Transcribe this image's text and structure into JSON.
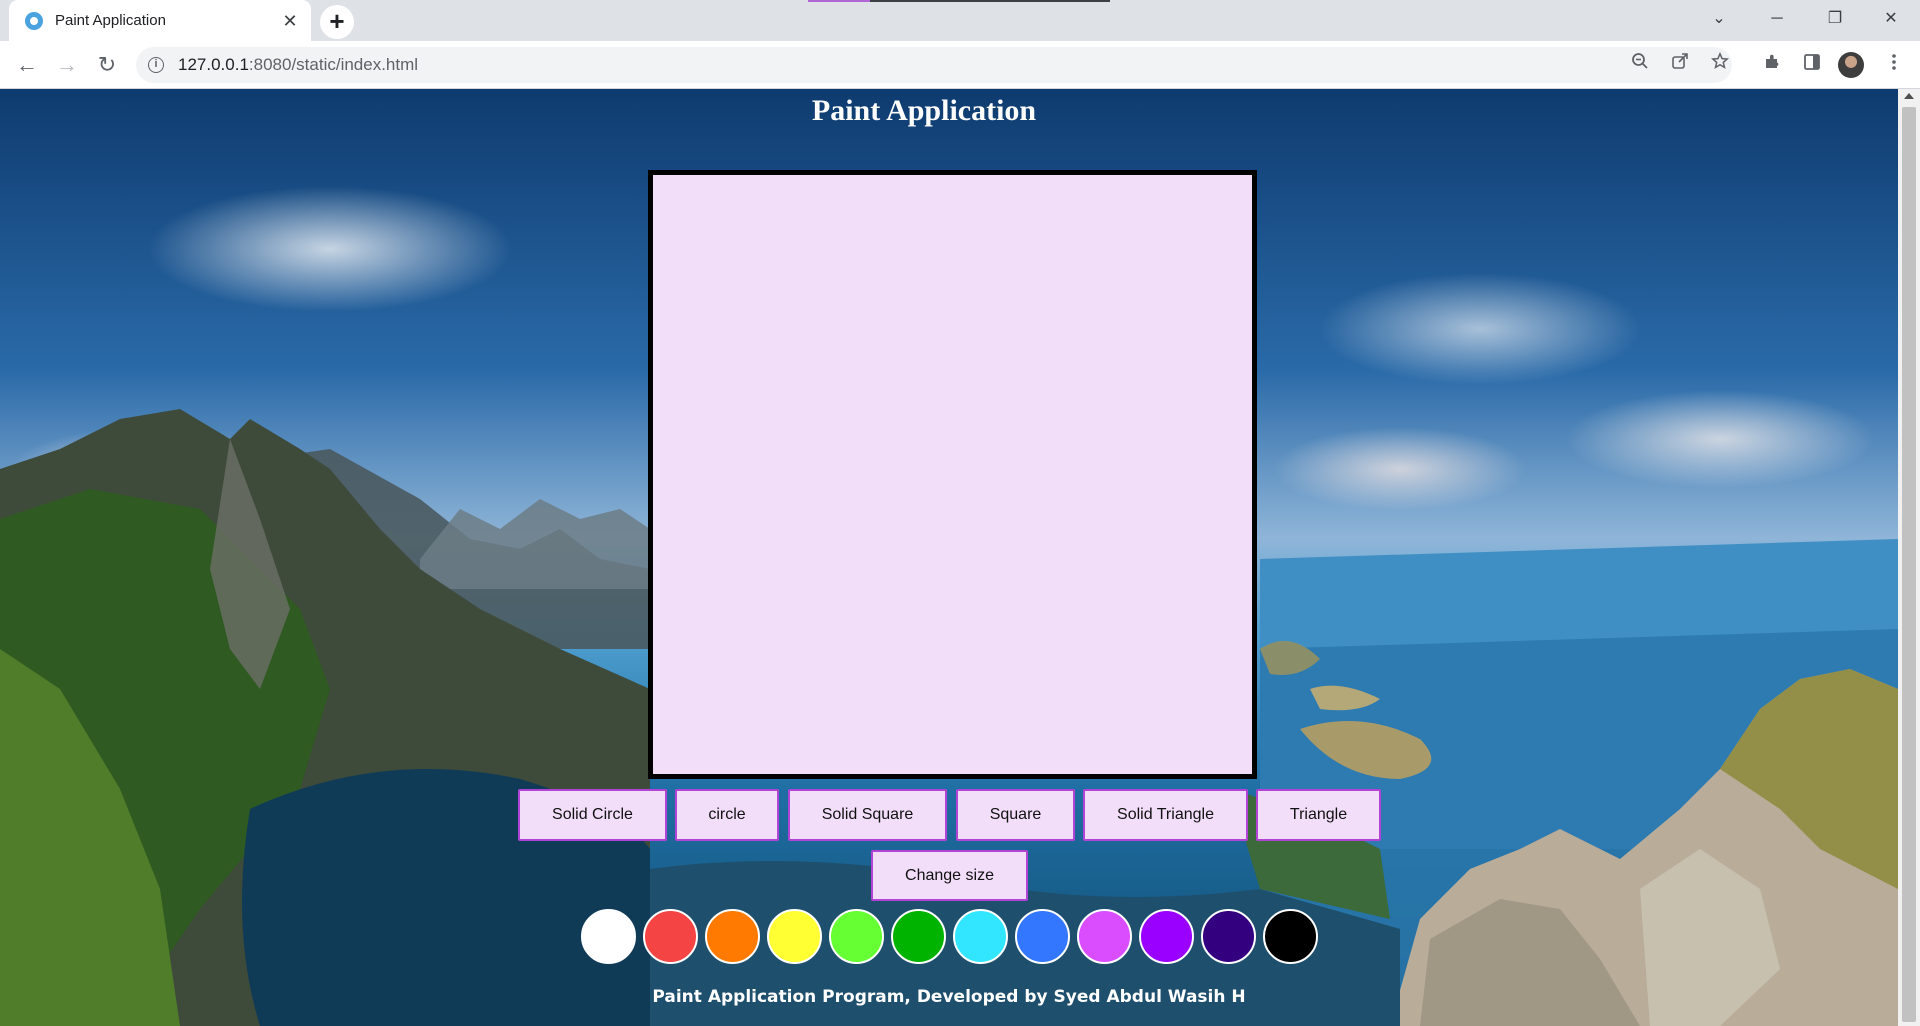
{
  "browser": {
    "tab_title": "Paint Application",
    "tab_close": "✕",
    "new_tab": "+",
    "url_host": "127.0.0.1",
    "url_path": ":8080/static/index.html",
    "window_controls": {
      "dropdown": "⌄",
      "minimize": "─",
      "maximize": "❐",
      "close": "✕"
    },
    "nav": {
      "back": "←",
      "forward": "→",
      "reload": "↻"
    },
    "icons": [
      "zoom-icon",
      "share-icon",
      "bookmark-star-icon",
      "extensions-icon",
      "side-panel-icon",
      "profile-avatar",
      "menu-icon"
    ]
  },
  "page": {
    "title": "Paint Application",
    "canvas_background": "#f2def9",
    "shape_buttons": [
      "Solid Circle",
      "circle",
      "Solid Square",
      "Square",
      "Solid Triangle",
      "Triangle"
    ],
    "size_button": "Change size",
    "colors": [
      "#ffffff",
      "#f44444",
      "#ff7a00",
      "#ffff33",
      "#66ff33",
      "#00b300",
      "#33e6ff",
      "#3377ff",
      "#d94dff",
      "#9900ff",
      "#330080",
      "#000000"
    ],
    "footer": "Paint Application Program, Developed by Syed Abdul Wasih H"
  }
}
